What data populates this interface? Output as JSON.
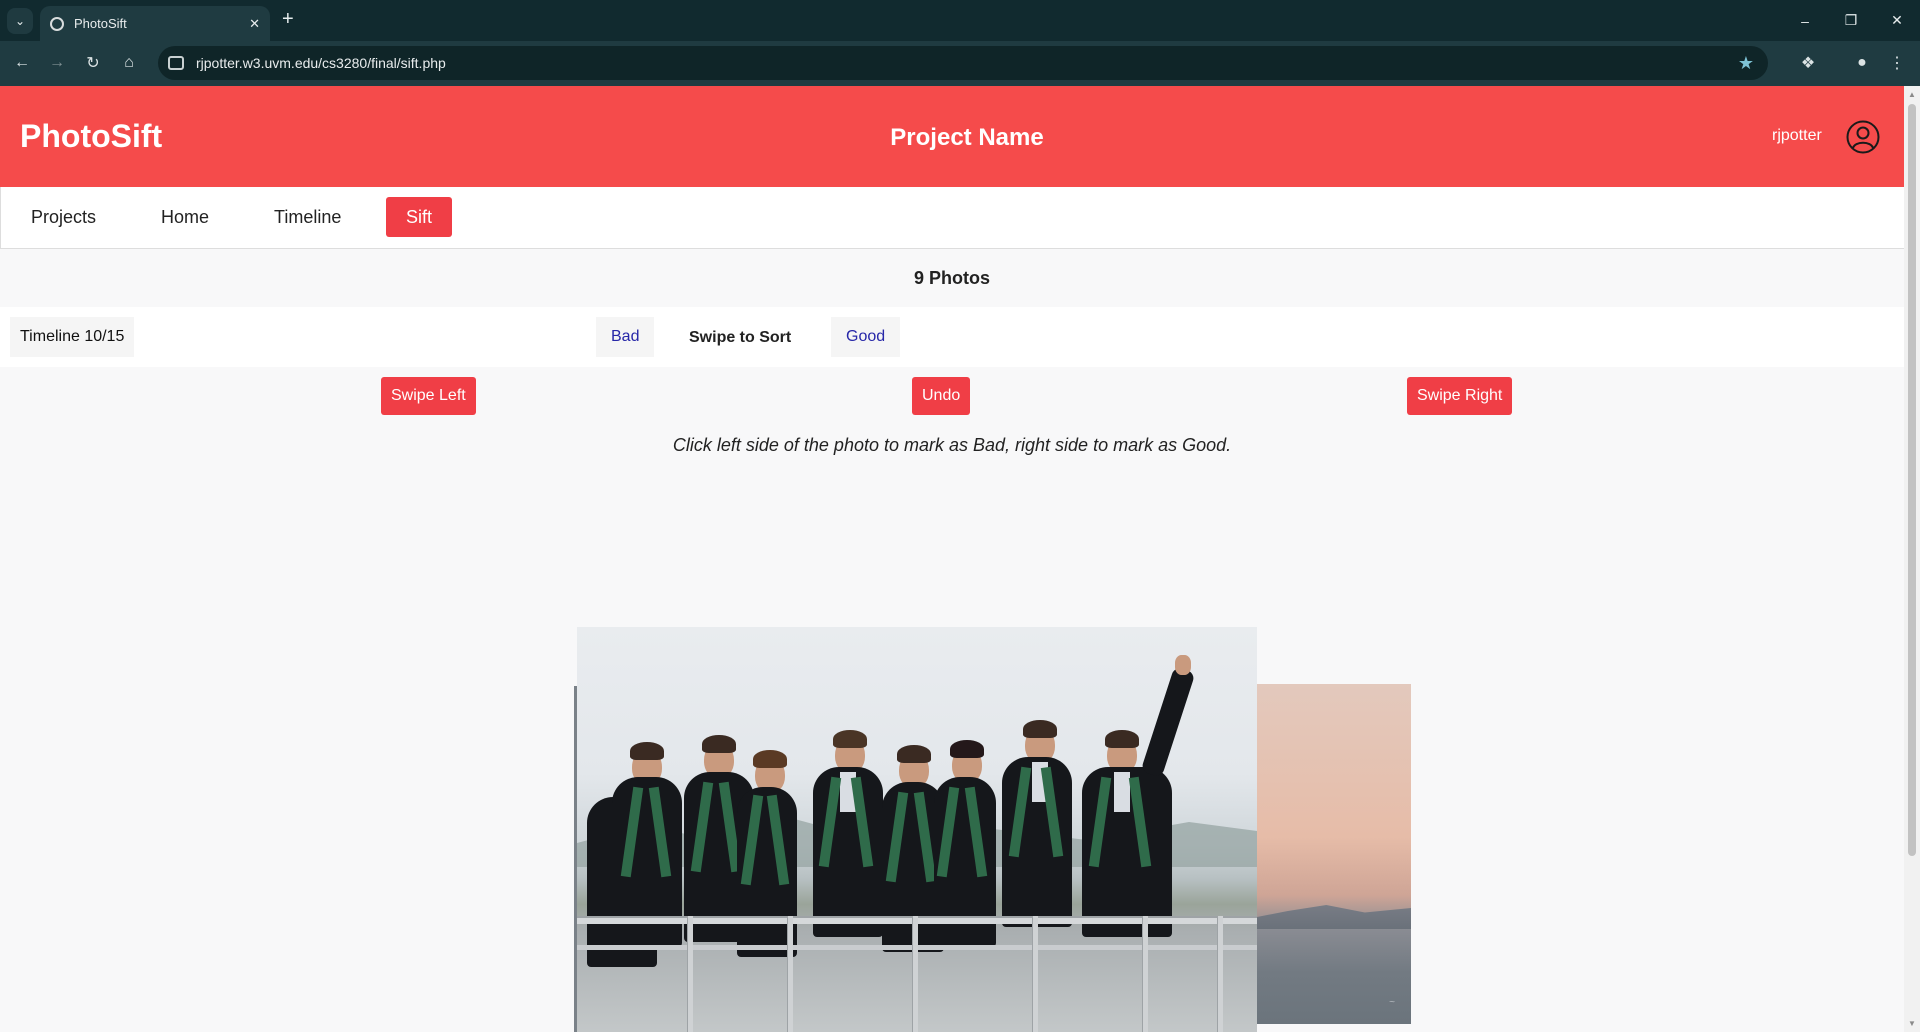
{
  "browser": {
    "tab_title": "PhotoSift",
    "url": "rjpotter.w3.uvm.edu/cs3280/final/sift.php"
  },
  "header": {
    "brand": "PhotoSift",
    "project_name": "Project Name",
    "username": "rjpotter"
  },
  "nav": {
    "items": [
      {
        "label": "Projects",
        "active": false
      },
      {
        "label": "Home",
        "active": false
      },
      {
        "label": "Timeline",
        "active": false
      },
      {
        "label": "Sift",
        "active": true
      }
    ]
  },
  "main": {
    "photo_count": "9 Photos",
    "timeline_label": "Timeline 10/15",
    "bad_label": "Bad",
    "sort_title": "Swipe to Sort",
    "good_label": "Good",
    "swipe_left": "Swipe Left",
    "undo": "Undo",
    "swipe_right": "Swipe Right",
    "hint": "Click left side of the photo to mark as Bad, right side to mark as Good."
  },
  "colors": {
    "brand_red": "#f54b4b",
    "button_red": "#f03e46",
    "link_blue": "#2727a8"
  }
}
